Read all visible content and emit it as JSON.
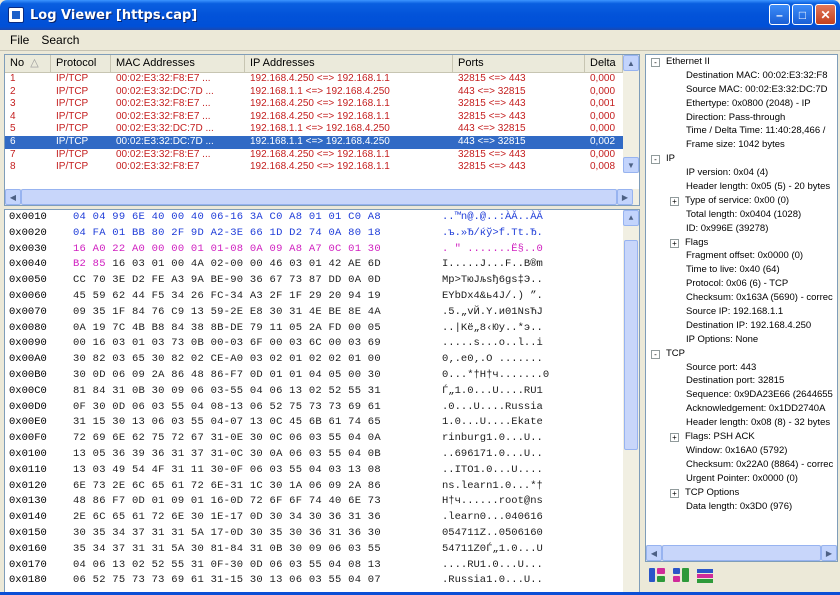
{
  "window": {
    "title": "Log Viewer [https.cap]"
  },
  "menu": {
    "file": "File",
    "search": "Search"
  },
  "packet_list": {
    "columns": [
      "No",
      "Protocol",
      "MAC Addresses",
      "IP Addresses",
      "Ports",
      "Delta"
    ],
    "rows": [
      {
        "no": "1",
        "proto": "IP/TCP",
        "mac": "00:02:E3:32:F8:E7 ...",
        "ip": "192.168.4.250 <=> 192.168.1.1",
        "ports": "32815 <=> 443",
        "delta": "0,000"
      },
      {
        "no": "2",
        "proto": "IP/TCP",
        "mac": "00:02:E3:32:DC:7D ...",
        "ip": "192.168.1.1 <=> 192.168.4.250",
        "ports": "443 <=> 32815",
        "delta": "0,000"
      },
      {
        "no": "3",
        "proto": "IP/TCP",
        "mac": "00:02:E3:32:F8:E7 ...",
        "ip": "192.168.4.250 <=> 192.168.1.1",
        "ports": "32815 <=> 443",
        "delta": "0,001"
      },
      {
        "no": "4",
        "proto": "IP/TCP",
        "mac": "00:02:E3:32:F8:E7 ...",
        "ip": "192.168.4.250 <=> 192.168.1.1",
        "ports": "32815 <=> 443",
        "delta": "0,000"
      },
      {
        "no": "5",
        "proto": "IP/TCP",
        "mac": "00:02:E3:32:DC:7D ...",
        "ip": "192.168.1.1 <=> 192.168.4.250",
        "ports": "443 <=> 32815",
        "delta": "0,000"
      },
      {
        "no": "6",
        "proto": "IP/TCP",
        "mac": "00:02:E3:32:DC:7D ...",
        "ip": "192.168.1.1 <=> 192.168.4.250",
        "ports": "443 <=> 32815",
        "delta": "0,002"
      },
      {
        "no": "7",
        "proto": "IP/TCP",
        "mac": "00:02:E3:32:F8:E7 ...",
        "ip": "192.168.4.250 <=> 192.168.1.1",
        "ports": "32815 <=> 443",
        "delta": "0,000"
      },
      {
        "no": "8",
        "proto": "IP/TCP",
        "mac": "00:02:E3:32:F8:E7",
        "ip": "192.168.4.250 <=> 192.168.1.1",
        "ports": "32815 <=> 443",
        "delta": "0,008"
      }
    ],
    "selected_index": 5
  },
  "hex": [
    {
      "off": "0x0010",
      "bytes": "04 04 99 6E 40 00 40 06-16 3A C0 A8 01 01 C0 A8",
      "ascii": "..™n@.@..:ÀĂ..ÀĂ",
      "style": "blue"
    },
    {
      "off": "0x0020",
      "bytes": "04 FA 01 BB 80 2F 9D A2-3E 66 1D D2 74 0A 80 18",
      "ascii": ".ъ.»Ђ/ќў>f.Tt.Ђ.",
      "style": "blue"
    },
    {
      "off": "0x0030",
      "bytes": "16 A0 22 A0 00 00 01 01-08 0A 09 A8 A7 0C 01 30",
      "ascii": ". \" .......Ё§..0",
      "style": "magenta"
    },
    {
      "off": "0x0040",
      "bytes": "B2 85 16 03 01 00 4A 02-00 00 46 03 01 42 AE 6D",
      "ascii": "І.....J...F..B®m",
      "style": "mixed"
    },
    {
      "off": "0x0050",
      "bytes": "CC 70 3E D2 FE A3 9A BE-90 36 67 73 87 DD 0A 0D",
      "ascii": "Мp>ТюЈљѕђ6gs‡Э..",
      "style": "dark"
    },
    {
      "off": "0x0060",
      "bytes": "45 59 62 44 F5 34 26 FC-34 A3 2F 1F 29 20 94 19",
      "ascii": "EYbDх4&ь4Ј/.) ”.",
      "style": "dark"
    },
    {
      "off": "0x0070",
      "bytes": "09 35 1F 84 76 C9 13 59-2E E8 30 31 4E BE 8E 4A",
      "ascii": ".5.„vЙ.Y.и01NѕЋJ",
      "style": "dark"
    },
    {
      "off": "0x0080",
      "bytes": "0A 19 7C 4B B8 84 38 8B-DE 79 11 05 2A FD 00 05",
      "ascii": "..|Kё„8‹Юy..*э..",
      "style": "dark"
    },
    {
      "off": "0x0090",
      "bytes": "00 16 03 01 03 73 0B 00-03 6F 00 03 6C 00 03 69",
      "ascii": ".....s...o..l..i",
      "style": "dark"
    },
    {
      "off": "0x00A0",
      "bytes": "30 82 03 65 30 82 02 CE-A0 03 02 01 02 02 01 00",
      "ascii": "0‚.e0‚.О .......",
      "style": "dark"
    },
    {
      "off": "0x00B0",
      "bytes": "30 0D 06 09 2A 86 48 86-F7 0D 01 01 04 05 00 30",
      "ascii": "0...*†H†ч.......0",
      "style": "dark"
    },
    {
      "off": "0x00C0",
      "bytes": "81 84 31 0B 30 09 06 03-55 04 06 13 02 52 55 31",
      "ascii": "Ѓ„1.0...U....RU1",
      "style": "dark"
    },
    {
      "off": "0x00D0",
      "bytes": "0F 30 0D 06 03 55 04 08-13 06 52 75 73 73 69 61",
      "ascii": ".0...U....Russia",
      "style": "dark"
    },
    {
      "off": "0x00E0",
      "bytes": "31 15 30 13 06 03 55 04-07 13 0C 45 6B 61 74 65",
      "ascii": "1.0...U....Ekate",
      "style": "dark"
    },
    {
      "off": "0x00F0",
      "bytes": "72 69 6E 62 75 72 67 31-0E 30 0C 06 03 55 04 0A",
      "ascii": "rinburg1.0...U..",
      "style": "dark"
    },
    {
      "off": "0x0100",
      "bytes": "13 05 36 39 36 31 37 31-0C 30 0A 06 03 55 04 0B",
      "ascii": "..696171.0...U..",
      "style": "dark"
    },
    {
      "off": "0x0110",
      "bytes": "13 03 49 54 4F 31 11 30-0F 06 03 55 04 03 13 08",
      "ascii": "..ITO1.0...U....",
      "style": "dark"
    },
    {
      "off": "0x0120",
      "bytes": "6E 73 2E 6C 65 61 72 6E-31 1C 30 1A 06 09 2A 86",
      "ascii": "ns.learn1.0...*†",
      "style": "dark"
    },
    {
      "off": "0x0130",
      "bytes": "48 86 F7 0D 01 09 01 16-0D 72 6F 6F 74 40 6E 73",
      "ascii": "H†ч......root@ns",
      "style": "dark"
    },
    {
      "off": "0x0140",
      "bytes": "2E 6C 65 61 72 6E 30 1E-17 0D 30 34 30 36 31 36",
      "ascii": ".learn0...040616",
      "style": "dark"
    },
    {
      "off": "0x0150",
      "bytes": "30 35 34 37 31 31 5A 17-0D 30 35 30 36 31 36 30",
      "ascii": "054711Z..0506160",
      "style": "dark"
    },
    {
      "off": "0x0160",
      "bytes": "35 34 37 31 31 5A 30 81-84 31 0B 30 09 06 03 55",
      "ascii": "54711Z0Ѓ„1.0...U",
      "style": "dark"
    },
    {
      "off": "0x0170",
      "bytes": "04 06 13 02 52 55 31 0F-30 0D 06 03 55 04 08 13",
      "ascii": "....RU1.0...U...",
      "style": "dark"
    },
    {
      "off": "0x0180",
      "bytes": "06 52 75 73 73 69 61 31-15 30 13 06 03 55 04 07",
      "ascii": ".Russia1.0...U..",
      "style": "dark"
    }
  ],
  "tree": [
    {
      "t": "Ethernet II",
      "lvl": 0,
      "box": "-"
    },
    {
      "t": "Destination MAC: 00:02:E3:32:F8",
      "lvl": 2
    },
    {
      "t": "Source MAC: 00:02:E3:32:DC:7D",
      "lvl": 2
    },
    {
      "t": "Ethertype: 0x0800 (2048) - IP",
      "lvl": 2
    },
    {
      "t": "Direction: Pass-through",
      "lvl": 2
    },
    {
      "t": "Time / Delta Time: 11:40:28,466 /",
      "lvl": 2
    },
    {
      "t": "Frame size: 1042 bytes",
      "lvl": 2
    },
    {
      "t": "IP",
      "lvl": 0,
      "box": "-"
    },
    {
      "t": "IP version: 0x04 (4)",
      "lvl": 2
    },
    {
      "t": "Header length: 0x05 (5) - 20 bytes",
      "lvl": 2
    },
    {
      "t": "Type of service: 0x00 (0)",
      "lvl": 1,
      "box": "+"
    },
    {
      "t": "Total length: 0x0404 (1028)",
      "lvl": 2
    },
    {
      "t": "ID: 0x996E (39278)",
      "lvl": 2
    },
    {
      "t": "Flags",
      "lvl": 1,
      "box": "+"
    },
    {
      "t": "Fragment offset: 0x0000 (0)",
      "lvl": 2
    },
    {
      "t": "Time to live: 0x40 (64)",
      "lvl": 2
    },
    {
      "t": "Protocol: 0x06 (6) - TCP",
      "lvl": 2
    },
    {
      "t": "Checksum: 0x163A (5690) - correc",
      "lvl": 2
    },
    {
      "t": "Source IP: 192.168.1.1",
      "lvl": 2
    },
    {
      "t": "Destination IP: 192.168.4.250",
      "lvl": 2
    },
    {
      "t": "IP Options: None",
      "lvl": 2
    },
    {
      "t": "TCP",
      "lvl": 0,
      "box": "-"
    },
    {
      "t": "Source port: 443",
      "lvl": 2
    },
    {
      "t": "Destination port: 32815",
      "lvl": 2
    },
    {
      "t": "Sequence: 0x9DA23E66 (2644655",
      "lvl": 2
    },
    {
      "t": "Acknowledgement: 0x1DD2740A",
      "lvl": 2
    },
    {
      "t": "Header length: 0x08 (8) - 32 bytes",
      "lvl": 2
    },
    {
      "t": "Flags: PSH ACK",
      "lvl": 1,
      "box": "+"
    },
    {
      "t": "Window: 0x16A0 (5792)",
      "lvl": 2
    },
    {
      "t": "Checksum: 0x22A0 (8864) - correc",
      "lvl": 2
    },
    {
      "t": "Urgent Pointer: 0x0000 (0)",
      "lvl": 2
    },
    {
      "t": "TCP Options",
      "lvl": 1,
      "box": "+"
    },
    {
      "t": "Data length: 0x3D0 (976)",
      "lvl": 2
    }
  ],
  "colors": {
    "selection": "#316ac5",
    "packet_text": "#c41e1e",
    "hex_blue": "#1e3cd8",
    "hex_magenta": "#d020c0"
  }
}
